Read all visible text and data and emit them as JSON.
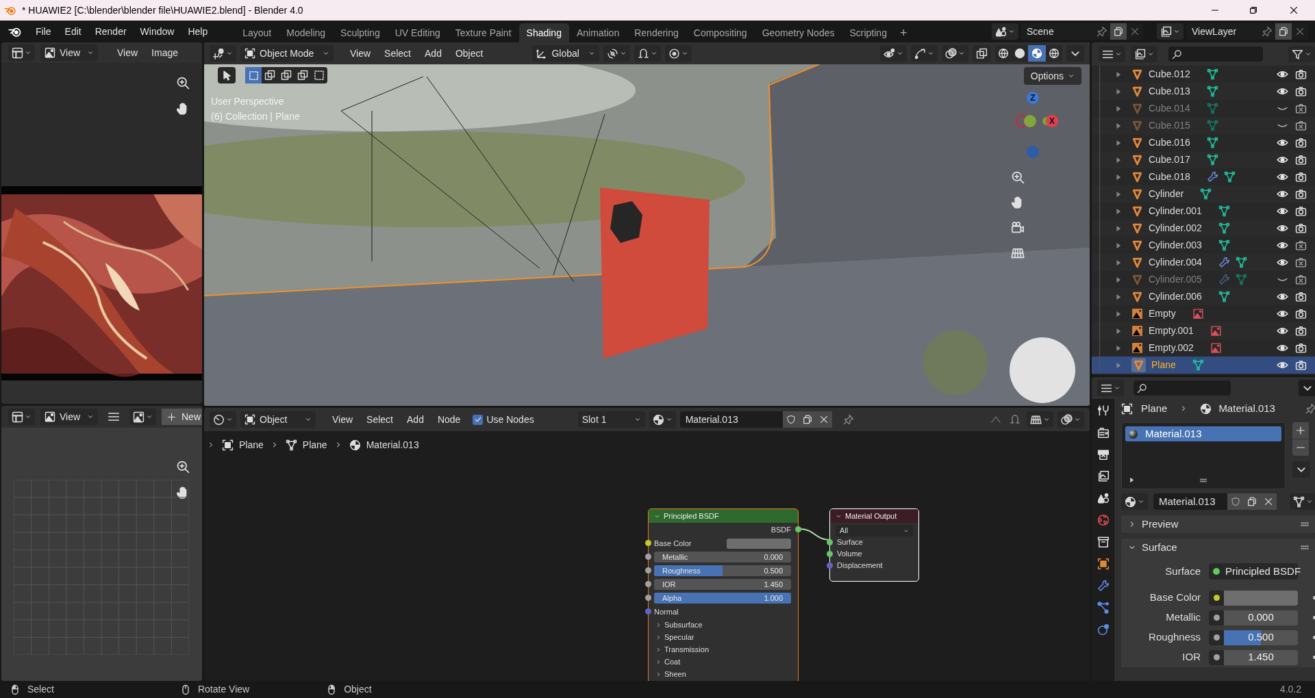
{
  "title_bar": {
    "title": "* HUAWIE2 [C:\\blender\\blender file\\HUAWIE2.blend] - Blender 4.0"
  },
  "menu": [
    "File",
    "Edit",
    "Render",
    "Window",
    "Help"
  ],
  "workspaces": [
    {
      "label": "Layout",
      "selected": false
    },
    {
      "label": "Modeling",
      "selected": false
    },
    {
      "label": "Sculpting",
      "selected": false
    },
    {
      "label": "UV Editing",
      "selected": false
    },
    {
      "label": "Texture Paint",
      "selected": false
    },
    {
      "label": "Shading",
      "selected": true
    },
    {
      "label": "Animation",
      "selected": false
    },
    {
      "label": "Rendering",
      "selected": false
    },
    {
      "label": "Compositing",
      "selected": false
    },
    {
      "label": "Geometry Nodes",
      "selected": false
    },
    {
      "label": "Scripting",
      "selected": false
    }
  ],
  "add_workspace": "+",
  "scene": "Scene",
  "view_layer": "ViewLayer",
  "image_editor": {
    "view_dropdown": "View",
    "menus": [
      "View",
      "Image"
    ]
  },
  "uv_editor": {
    "view_dropdown": "View",
    "new_button": "New"
  },
  "viewport": {
    "mode": "Object Mode",
    "menus": [
      "View",
      "Select",
      "Add",
      "Object"
    ],
    "orientation": "Global",
    "options": "Options",
    "info": [
      "User Perspective",
      "(6) Collection | Plane"
    ],
    "axes": [
      "Z",
      "X"
    ]
  },
  "node_editor": {
    "type": "Object",
    "menus": [
      "View",
      "Select",
      "Add",
      "Node"
    ],
    "use_nodes": {
      "label": "Use Nodes",
      "checked": true
    },
    "slot": "Slot 1",
    "material": "Material.013",
    "breadcrumbs": [
      {
        "kind": "object",
        "label": "Plane"
      },
      {
        "kind": "mesh",
        "label": "Plane"
      },
      {
        "kind": "material",
        "label": "Material.013"
      }
    ],
    "principled": {
      "title": "Principled BSDF",
      "output": "BSDF",
      "inputs": [
        {
          "kind": "color",
          "label": "Base Color",
          "color": "#c7c729"
        },
        {
          "kind": "slider",
          "label": "Metallic",
          "value": "0.000",
          "level": 0,
          "color": "#a1a1a1"
        },
        {
          "kind": "slider",
          "label": "Roughness",
          "value": "0.500",
          "level": 0.5,
          "color": "#a1a1a1"
        },
        {
          "kind": "slider",
          "label": "IOR",
          "value": "1.450",
          "level": 0,
          "color": "#a1a1a1"
        },
        {
          "kind": "slider",
          "label": "Alpha",
          "value": "1.000",
          "level": 1,
          "color": "#a1a1a1"
        },
        {
          "kind": "socket",
          "label": "Normal",
          "color": "#6363c7"
        },
        {
          "kind": "panel",
          "label": "Subsurface"
        },
        {
          "kind": "panel",
          "label": "Specular"
        },
        {
          "kind": "panel",
          "label": "Transmission"
        },
        {
          "kind": "panel",
          "label": "Coat"
        },
        {
          "kind": "panel",
          "label": "Sheen"
        }
      ]
    },
    "output": {
      "title": "Material Output",
      "target": "All",
      "inputs": [
        {
          "label": "Surface",
          "color": "#63c763"
        },
        {
          "label": "Volume",
          "color": "#63c763"
        },
        {
          "label": "Displacement",
          "color": "#6363c7"
        }
      ]
    }
  },
  "outliner": {
    "rows": [
      {
        "name": "Cube.012",
        "kind": "mesh",
        "modifier": false,
        "visible": true,
        "renderable": true,
        "selected": false
      },
      {
        "name": "Cube.013",
        "kind": "mesh",
        "modifier": false,
        "visible": true,
        "renderable": true,
        "selected": false
      },
      {
        "name": "Cube.014",
        "kind": "mesh",
        "modifier": false,
        "visible": false,
        "renderable": false,
        "selected": false
      },
      {
        "name": "Cube.015",
        "kind": "mesh",
        "modifier": false,
        "visible": false,
        "renderable": false,
        "selected": false
      },
      {
        "name": "Cube.016",
        "kind": "mesh",
        "modifier": false,
        "visible": true,
        "renderable": true,
        "selected": false
      },
      {
        "name": "Cube.017",
        "kind": "mesh",
        "modifier": false,
        "visible": true,
        "renderable": true,
        "selected": false
      },
      {
        "name": "Cube.018",
        "kind": "mesh",
        "modifier": true,
        "visible": true,
        "renderable": true,
        "selected": false
      },
      {
        "name": "Cylinder",
        "kind": "mesh",
        "modifier": false,
        "visible": true,
        "renderable": true,
        "selected": false
      },
      {
        "name": "Cylinder.001",
        "kind": "mesh",
        "modifier": false,
        "visible": true,
        "renderable": true,
        "selected": false
      },
      {
        "name": "Cylinder.002",
        "kind": "mesh",
        "modifier": false,
        "visible": true,
        "renderable": true,
        "selected": false
      },
      {
        "name": "Cylinder.003",
        "kind": "mesh",
        "modifier": false,
        "visible": true,
        "renderable": false,
        "selected": false
      },
      {
        "name": "Cylinder.004",
        "kind": "mesh",
        "modifier": true,
        "visible": true,
        "renderable": false,
        "selected": false
      },
      {
        "name": "Cylinder.005",
        "kind": "mesh",
        "modifier": true,
        "visible": false,
        "renderable": false,
        "selected": false
      },
      {
        "name": "Cylinder.006",
        "kind": "mesh",
        "modifier": false,
        "visible": true,
        "renderable": true,
        "selected": false
      },
      {
        "name": "Empty",
        "kind": "empty",
        "modifier": false,
        "visible": true,
        "renderable": true,
        "selected": false
      },
      {
        "name": "Empty.001",
        "kind": "empty",
        "modifier": false,
        "visible": true,
        "renderable": true,
        "selected": false
      },
      {
        "name": "Empty.002",
        "kind": "empty",
        "modifier": false,
        "visible": true,
        "renderable": true,
        "selected": false
      },
      {
        "name": "Plane",
        "kind": "mesh",
        "modifier": false,
        "visible": true,
        "renderable": true,
        "selected": true
      }
    ]
  },
  "properties": {
    "breadcrumbs": [
      "Plane",
      "Material.013"
    ],
    "slots": [
      {
        "name": "Material.013",
        "selected": true
      }
    ],
    "material": "Material.013",
    "sections": [
      {
        "label": "Preview",
        "expanded": false
      },
      {
        "label": "Surface",
        "expanded": true
      }
    ],
    "fields": [
      {
        "kind": "shader",
        "label": "Surface",
        "value": "Principled BSDF",
        "color": "#5ec95e"
      },
      {
        "kind": "color",
        "label": "Base Color",
        "color": "#c7c729"
      },
      {
        "kind": "slider",
        "label": "Metallic",
        "value": "0.000",
        "level": 0
      },
      {
        "kind": "slider",
        "label": "Roughness",
        "value": "0.500",
        "level": 0.5
      },
      {
        "kind": "slider",
        "label": "IOR",
        "value": "1.450",
        "level": 0
      }
    ]
  },
  "status_bar": {
    "items": [
      "Select",
      "Rotate View",
      "Object"
    ],
    "version": "4.0.2"
  }
}
